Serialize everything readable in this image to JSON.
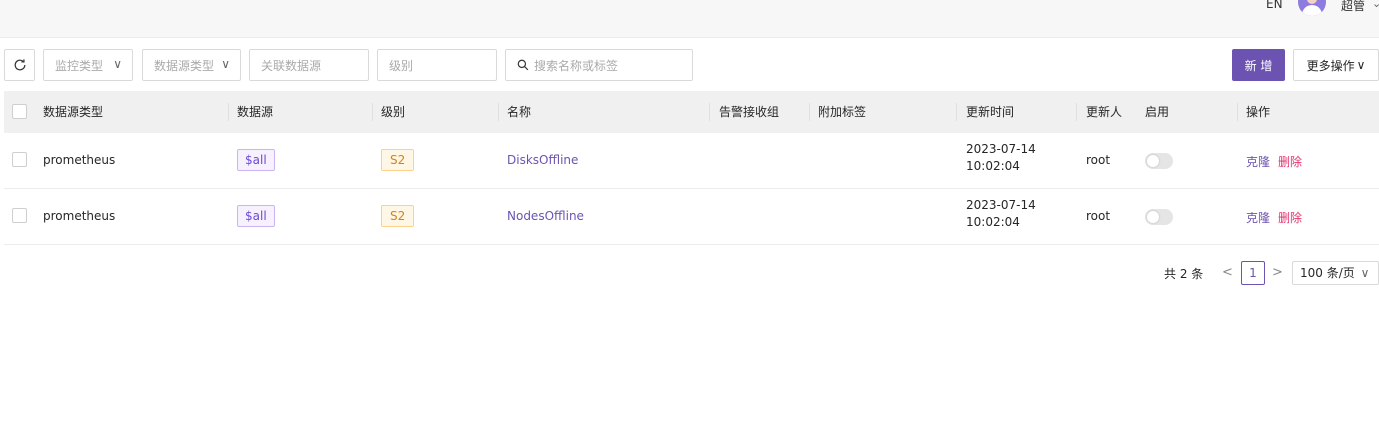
{
  "header": {
    "language": "EN",
    "username": "超管",
    "user_menu_icon": "chevron-down-icon"
  },
  "toolbar": {
    "refresh_icon": "refresh-icon",
    "monitor_type_placeholder": "监控类型",
    "datasource_type_placeholder": "数据源类型",
    "related_datasource_placeholder": "关联数据源",
    "level_placeholder": "级别",
    "search_placeholder": "搜索名称或标签",
    "add_label": "新 增",
    "more_label": "更多操作"
  },
  "table": {
    "columns": [
      "数据源类型",
      "数据源",
      "级别",
      "名称",
      "告警接收组",
      "附加标签",
      "更新时间",
      "更新人",
      "启用",
      "操作"
    ],
    "rows": [
      {
        "datasource_type": "prometheus",
        "datasource": "$all",
        "level": "S2",
        "name": "DisksOffline",
        "notify_groups": "",
        "extra_tags": "",
        "update_date": "2023-07-14",
        "update_time": "10:02:04",
        "updated_by": "root",
        "enabled": false,
        "action_clone": "克隆",
        "action_delete": "删除"
      },
      {
        "datasource_type": "prometheus",
        "datasource": "$all",
        "level": "S2",
        "name": "NodesOffline",
        "notify_groups": "",
        "extra_tags": "",
        "update_date": "2023-07-14",
        "update_time": "10:02:04",
        "updated_by": "root",
        "enabled": false,
        "action_clone": "克隆",
        "action_delete": "删除"
      }
    ]
  },
  "pagination": {
    "total_text": "共 2 条",
    "current_page": "1",
    "page_size": "100 条/页"
  },
  "colors": {
    "primary": "#6c53b1",
    "danger": "#e0356b",
    "tag_all": "#6c4bd1",
    "tag_s2": "#d4831a"
  }
}
